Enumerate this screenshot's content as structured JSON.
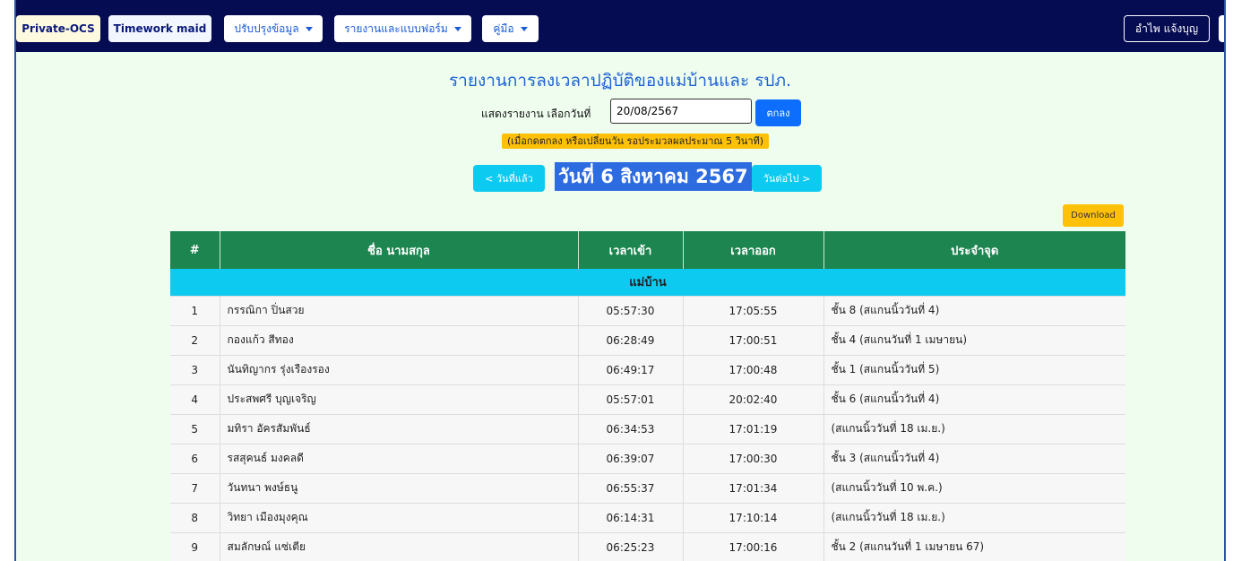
{
  "nav": {
    "brand": "Private-OCS",
    "timework": "Timework maid",
    "update_menu": "ปรับปรุงข้อมูล",
    "reports_menu": "รายงานและแบบฟอร์ม",
    "manual_menu": "คู่มือ",
    "user": "อำไพ แจ้งบุญ"
  },
  "page": {
    "title": "รายงานการลงเวลาปฏิบัติของแม่บ้านและ รปภ.",
    "form_label": "แสดงรายงาน เลือกวันที่",
    "date_value": "20/08/2567",
    "ok_button": "ตกลง",
    "note": "(เมื่อกดตกลง หรือเปลี่ยนวัน รอประมวลผลประมาณ 5 วินาที)",
    "prev_button": "< วันที่แล้ว",
    "current_date": "วันที่ 6 สิงหาคม 2567",
    "next_button": "วันต่อไป >",
    "download_button": "Download"
  },
  "table": {
    "headers": [
      "#",
      "ชื่อ นามสกุล",
      "เวลาเข้า",
      "เวลาออก",
      "ประจำจุด"
    ],
    "group_label": "แม่บ้าน",
    "rows": [
      [
        "1",
        "กรรณิกา ปิ่นสวย",
        "05:57:30",
        "17:05:55",
        "ชั้น 8 (สแกนนิ้ววันที่ 4)"
      ],
      [
        "2",
        "กองแก้ว สีทอง",
        "06:28:49",
        "17:00:51",
        "ชั้น 4 (สแกนวันที่ 1 เมษายน)"
      ],
      [
        "3",
        "นันทิญากร รุ่งเรืองรอง",
        "06:49:17",
        "17:00:48",
        "ชั้น 1 (สแกนนิ้ววันที่ 5)"
      ],
      [
        "4",
        "ประสพศรี บุญเจริญ",
        "05:57:01",
        "20:02:40",
        "ชั้น 6 (สแกนนิ้ววันที่ 4)"
      ],
      [
        "5",
        "มทิรา อัครสัมพันธ์",
        "06:34:53",
        "17:01:19",
        "(สแกนนิ้ววันที่ 18 เม.ย.)"
      ],
      [
        "6",
        "รสสุคนธ์ มงคลดี",
        "06:39:07",
        "17:00:30",
        "ชั้น 3 (สแกนนิ้ววันที่ 4)"
      ],
      [
        "7",
        "วันทนา พงษ์ธนู",
        "06:55:37",
        "17:01:34",
        "(สแกนนิ้ววันที่ 10 พ.ค.)"
      ],
      [
        "8",
        "วิทยา เมืองมุงคุณ",
        "06:14:31",
        "17:10:14",
        "(สแกนนิ้ววันที่ 18 เม.ย.)"
      ],
      [
        "9",
        "สมลักษณ์ แซ่เตีย",
        "06:25:23",
        "17:00:16",
        "ชั้น 2 (สแกนวันที่ 1 เมษายน 67)"
      ]
    ]
  },
  "colors": {
    "navbar": "#060c52",
    "page_bg": "#effdef",
    "table_header": "#1c8550",
    "group_row": "#0dcaf0",
    "primary": "#0d6efd",
    "warning": "#ffc107"
  }
}
